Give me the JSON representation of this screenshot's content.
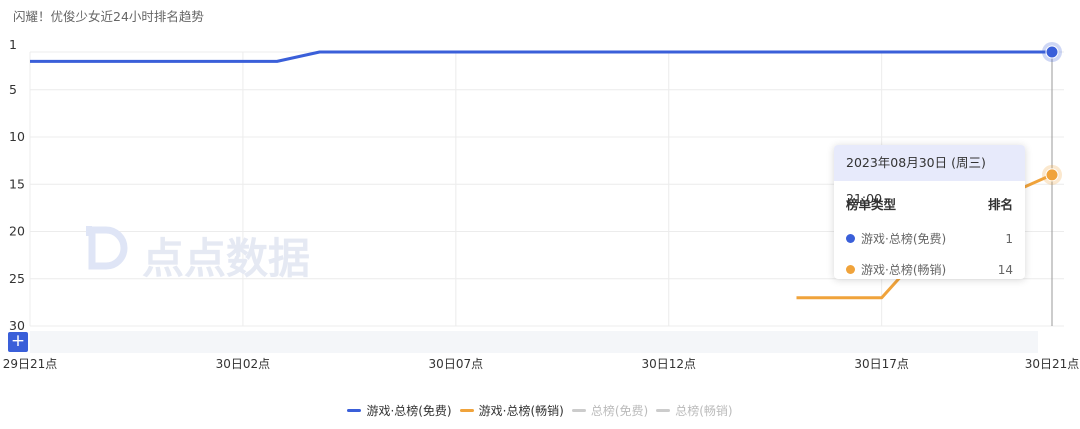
{
  "chart_data": {
    "type": "line",
    "title": "闪耀！优俊少女近24小时排名趋势",
    "x_ticks": [
      "29日21点",
      "30日02点",
      "30日07点",
      "30日12点",
      "30日17点",
      "30日21点"
    ],
    "y_ticks": [
      1,
      5,
      10,
      15,
      20,
      25,
      30
    ],
    "ylim": [
      1,
      30
    ],
    "y_inverted": true,
    "grid": true,
    "legend_position": "bottom",
    "series": [
      {
        "name": "游戏·总榜(免费)",
        "color": "#3a5fd9",
        "visible": true,
        "points": [
          [
            0,
            2
          ],
          [
            3,
            2
          ],
          [
            5.8,
            2
          ],
          [
            6.8,
            1
          ],
          [
            12,
            1
          ],
          [
            17,
            1
          ],
          [
            24,
            1
          ]
        ]
      },
      {
        "name": "游戏·总榜(畅销)",
        "color": "#f0a33b",
        "visible": true,
        "points": [
          [
            18,
            27
          ],
          [
            20,
            27
          ],
          [
            21,
            22
          ],
          [
            22,
            19
          ],
          [
            23,
            16
          ],
          [
            24,
            14
          ]
        ]
      },
      {
        "name": "总榜(免费)",
        "color": "#cccccc",
        "visible": false,
        "points": []
      },
      {
        "name": "总榜(畅销)",
        "color": "#cccccc",
        "visible": false,
        "points": []
      }
    ]
  },
  "tooltip": {
    "header": "2023年08月30日 (周三) 21:00",
    "col_type": "榜单类型",
    "col_rank": "排名",
    "rows": [
      {
        "name": "游戏·总榜(免费)",
        "value": "1",
        "color": "#3a5fd9"
      },
      {
        "name": "游戏·总榜(畅销)",
        "value": "14",
        "color": "#f0a33b"
      }
    ]
  },
  "watermark": "点点数据",
  "zoom_label": "+"
}
